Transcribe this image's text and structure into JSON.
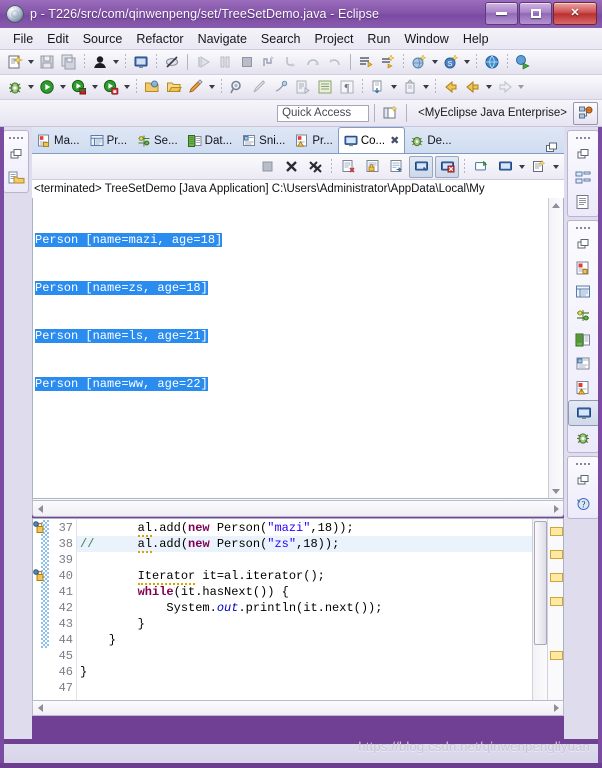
{
  "window": {
    "title": "p - T226/src/com/qinwenpeng/set/TreeSetDemo.java - Eclipse",
    "app_icon": "eclipse-icon",
    "minimize_label": "Minimize",
    "maximize_label": "Maximize",
    "close_label": "Close"
  },
  "menubar": {
    "items": [
      {
        "label": "File"
      },
      {
        "label": "Edit"
      },
      {
        "label": "Source"
      },
      {
        "label": "Refactor"
      },
      {
        "label": "Navigate"
      },
      {
        "label": "Search"
      },
      {
        "label": "Project"
      },
      {
        "label": "Run"
      },
      {
        "label": "Window"
      },
      {
        "label": "Help"
      }
    ]
  },
  "toolbar_row1": {
    "buttons": [
      {
        "icon": "new-wizard-icon",
        "dropdown": true
      },
      {
        "icon": "save-icon",
        "dropdown": false
      },
      {
        "icon": "save-all-icon",
        "dropdown": false
      },
      {
        "icon": "user-icon",
        "dropdown": true
      },
      {
        "icon": "open-console-icon",
        "dropdown": false
      },
      {
        "icon": "skip-breakpoints-icon",
        "dropdown": false
      },
      {
        "icon": "resume-icon",
        "dropdown": false
      },
      {
        "icon": "suspend-icon",
        "dropdown": false
      },
      {
        "icon": "terminate-icon",
        "dropdown": false
      },
      {
        "icon": "disconnect-icon",
        "dropdown": false
      },
      {
        "icon": "step-into-icon",
        "dropdown": false
      },
      {
        "icon": "step-over-icon",
        "dropdown": false
      },
      {
        "icon": "step-return-icon",
        "dropdown": false
      },
      {
        "icon": "next-annotation-icon",
        "dropdown": false
      },
      {
        "icon": "quick-fix-icon",
        "dropdown": false
      },
      {
        "icon": "new-java-package-icon",
        "dropdown": true
      },
      {
        "icon": "new-class-icon",
        "dropdown": true
      },
      {
        "icon": "web-browser-icon",
        "dropdown": false
      },
      {
        "icon": "run-web-app-icon",
        "dropdown": false
      }
    ]
  },
  "toolbar_row2": {
    "buttons": [
      {
        "icon": "debug-icon",
        "dropdown": true
      },
      {
        "icon": "run-icon",
        "dropdown": true
      },
      {
        "icon": "run-server-icon",
        "dropdown": true
      },
      {
        "icon": "run-stop-server-icon",
        "dropdown": true
      },
      {
        "icon": "open-folder-icon",
        "dropdown": false
      },
      {
        "icon": "export-folder-icon",
        "dropdown": false
      },
      {
        "icon": "pencil-icon",
        "dropdown": true
      },
      {
        "icon": "search-ref-icon",
        "dropdown": false
      },
      {
        "icon": "brush-icon",
        "dropdown": false
      },
      {
        "icon": "spell-icon",
        "dropdown": false
      },
      {
        "icon": "open-type-icon",
        "dropdown": false
      },
      {
        "icon": "open-task-icon",
        "dropdown": false
      },
      {
        "icon": "paragraph-icon",
        "dropdown": false
      },
      {
        "icon": "toggle-mark-icon",
        "dropdown": true
      },
      {
        "icon": "last-edit-icon",
        "dropdown": true
      },
      {
        "icon": "back-icon",
        "dropdown": false
      },
      {
        "icon": "prev-icon",
        "dropdown": true
      },
      {
        "icon": "forward-icon",
        "dropdown": true
      }
    ]
  },
  "quick_access": {
    "placeholder": "Quick Access",
    "value": "Quick Access",
    "open_perspective_icon": "open-perspective-icon",
    "perspective_name": "<MyEclipse Java Enterprise>",
    "perspective_icon": "myeclipse-perspective-icon"
  },
  "left_rail": {
    "restore_icon": "restore-view-icon",
    "items": [
      {
        "icon": "package-explorer-icon",
        "label": "Package Explorer"
      }
    ]
  },
  "right_rail": {
    "groups": [
      {
        "restore_icon": "restore-view-icon",
        "items": [
          {
            "icon": "outline-icon",
            "label": "Outline"
          },
          {
            "icon": "task-list-icon",
            "label": "Task List"
          }
        ]
      },
      {
        "restore_icon": "restore-view-icon",
        "items": [
          {
            "icon": "markers-icon",
            "label": "Markers"
          },
          {
            "icon": "properties-icon",
            "label": "Properties"
          },
          {
            "icon": "servers-icon",
            "label": "Servers"
          },
          {
            "icon": "data-source-explorer-icon",
            "label": "Data Source Explorer"
          },
          {
            "icon": "snippets-icon",
            "label": "Snippets"
          },
          {
            "icon": "problems-icon",
            "label": "Problems"
          },
          {
            "icon": "console-icon",
            "label": "Console",
            "active": true
          },
          {
            "icon": "debug-bug-icon",
            "label": "Debug"
          }
        ]
      },
      {
        "restore_icon": "restore-view-icon",
        "items": [
          {
            "icon": "help-icon",
            "label": "Help"
          }
        ]
      }
    ]
  },
  "console_view": {
    "tabs": [
      {
        "label": "Ma...",
        "icon": "markers-icon",
        "active": false,
        "closable": false
      },
      {
        "label": "Pr...",
        "icon": "properties-icon",
        "active": false,
        "closable": false
      },
      {
        "label": "Se...",
        "icon": "servers-icon",
        "active": false,
        "closable": false
      },
      {
        "label": "Dat...",
        "icon": "data-source-explorer-icon",
        "active": false,
        "closable": false
      },
      {
        "label": "Sni...",
        "icon": "snippets-icon",
        "active": false,
        "closable": false
      },
      {
        "label": "Pr...",
        "icon": "problems-icon",
        "active": false,
        "closable": false
      },
      {
        "label": "Co...",
        "icon": "console-icon",
        "active": true,
        "closable": true
      },
      {
        "label": "De...",
        "icon": "debug-bug-icon",
        "active": false,
        "closable": false
      }
    ],
    "close_glyph": "✖",
    "maximize_icon": "maximize-view-icon",
    "toolbar": [
      {
        "icon": "terminate-icon",
        "pressed": false
      },
      {
        "icon": "remove-launch-icon",
        "pressed": false
      },
      {
        "icon": "remove-all-terminated-icon",
        "pressed": false
      },
      {
        "icon": "clear-console-icon",
        "pressed": false
      },
      {
        "icon": "scroll-lock-icon",
        "pressed": false
      },
      {
        "icon": "word-wrap-icon",
        "pressed": false
      },
      {
        "icon": "pin-console-icon",
        "pressed": true
      },
      {
        "icon": "display-selected-console-icon",
        "pressed": true
      },
      {
        "icon": "open-console-icon",
        "pressed": false
      },
      {
        "icon": "console-view-menu-icon",
        "pressed": false
      },
      {
        "icon": "new-console-view-icon",
        "pressed": false
      }
    ],
    "header": "<terminated> TreeSetDemo [Java Application] C:\\Users\\Administrator\\AppData\\Local\\My",
    "output_lines": [
      "Person [name=mazi, age=18]",
      "Person [name=zs, age=18]",
      "Person [name=ls, age=21]",
      "Person [name=ww, age=22]"
    ],
    "selection_color": "#2b8cf0"
  },
  "editor": {
    "first_line": 37,
    "lines": [
      {
        "n": "37",
        "changed": true,
        "marker": "warning",
        "highlight": false,
        "tokens": [
          {
            "t": "        ",
            "c": ""
          },
          {
            "t": "al",
            "c": "warnu"
          },
          {
            "t": ".add(",
            "c": ""
          },
          {
            "t": "new",
            "c": "kw"
          },
          {
            "t": " Person(",
            "c": ""
          },
          {
            "t": "\"mazi\"",
            "c": "str"
          },
          {
            "t": ",18));",
            "c": ""
          }
        ]
      },
      {
        "n": "38",
        "changed": true,
        "marker": "none",
        "highlight": true,
        "tokens": [
          {
            "t": "//",
            "c": "cmt"
          },
          {
            "t": "      ",
            "c": ""
          },
          {
            "t": "al",
            "c": "warnu"
          },
          {
            "t": ".add(",
            "c": ""
          },
          {
            "t": "new",
            "c": "kw"
          },
          {
            "t": " Person(",
            "c": ""
          },
          {
            "t": "\"zs\"",
            "c": "str"
          },
          {
            "t": ",18));",
            "c": ""
          }
        ]
      },
      {
        "n": "39",
        "changed": true,
        "marker": "none",
        "highlight": false,
        "tokens": []
      },
      {
        "n": "40",
        "changed": true,
        "marker": "warning",
        "highlight": false,
        "tokens": [
          {
            "t": "        ",
            "c": ""
          },
          {
            "t": "Iterator",
            "c": "warnu"
          },
          {
            "t": " it=al.iterator();",
            "c": ""
          }
        ]
      },
      {
        "n": "41",
        "changed": true,
        "marker": "none",
        "highlight": false,
        "tokens": [
          {
            "t": "        ",
            "c": ""
          },
          {
            "t": "while",
            "c": "kw"
          },
          {
            "t": "(it.hasNext()) {",
            "c": ""
          }
        ]
      },
      {
        "n": "42",
        "changed": true,
        "marker": "none",
        "highlight": false,
        "tokens": [
          {
            "t": "            System.",
            "c": ""
          },
          {
            "t": "out",
            "c": "fld"
          },
          {
            "t": ".println(it.next());",
            "c": ""
          }
        ]
      },
      {
        "n": "43",
        "changed": true,
        "marker": "none",
        "highlight": false,
        "tokens": [
          {
            "t": "        }",
            "c": ""
          }
        ]
      },
      {
        "n": "44",
        "changed": true,
        "marker": "none",
        "highlight": false,
        "tokens": [
          {
            "t": "    }",
            "c": ""
          }
        ]
      },
      {
        "n": "45",
        "changed": false,
        "marker": "none",
        "highlight": false,
        "tokens": []
      },
      {
        "n": "46",
        "changed": false,
        "marker": "none",
        "highlight": false,
        "tokens": [
          {
            "t": "}",
            "c": ""
          }
        ]
      },
      {
        "n": "47",
        "changed": false,
        "marker": "none",
        "highlight": false,
        "tokens": []
      }
    ],
    "overview_markers_pct": [
      4,
      16,
      28,
      40,
      68
    ]
  },
  "watermark": {
    "text": "https://blog.csdn.net/qinwenpengliyuan"
  }
}
